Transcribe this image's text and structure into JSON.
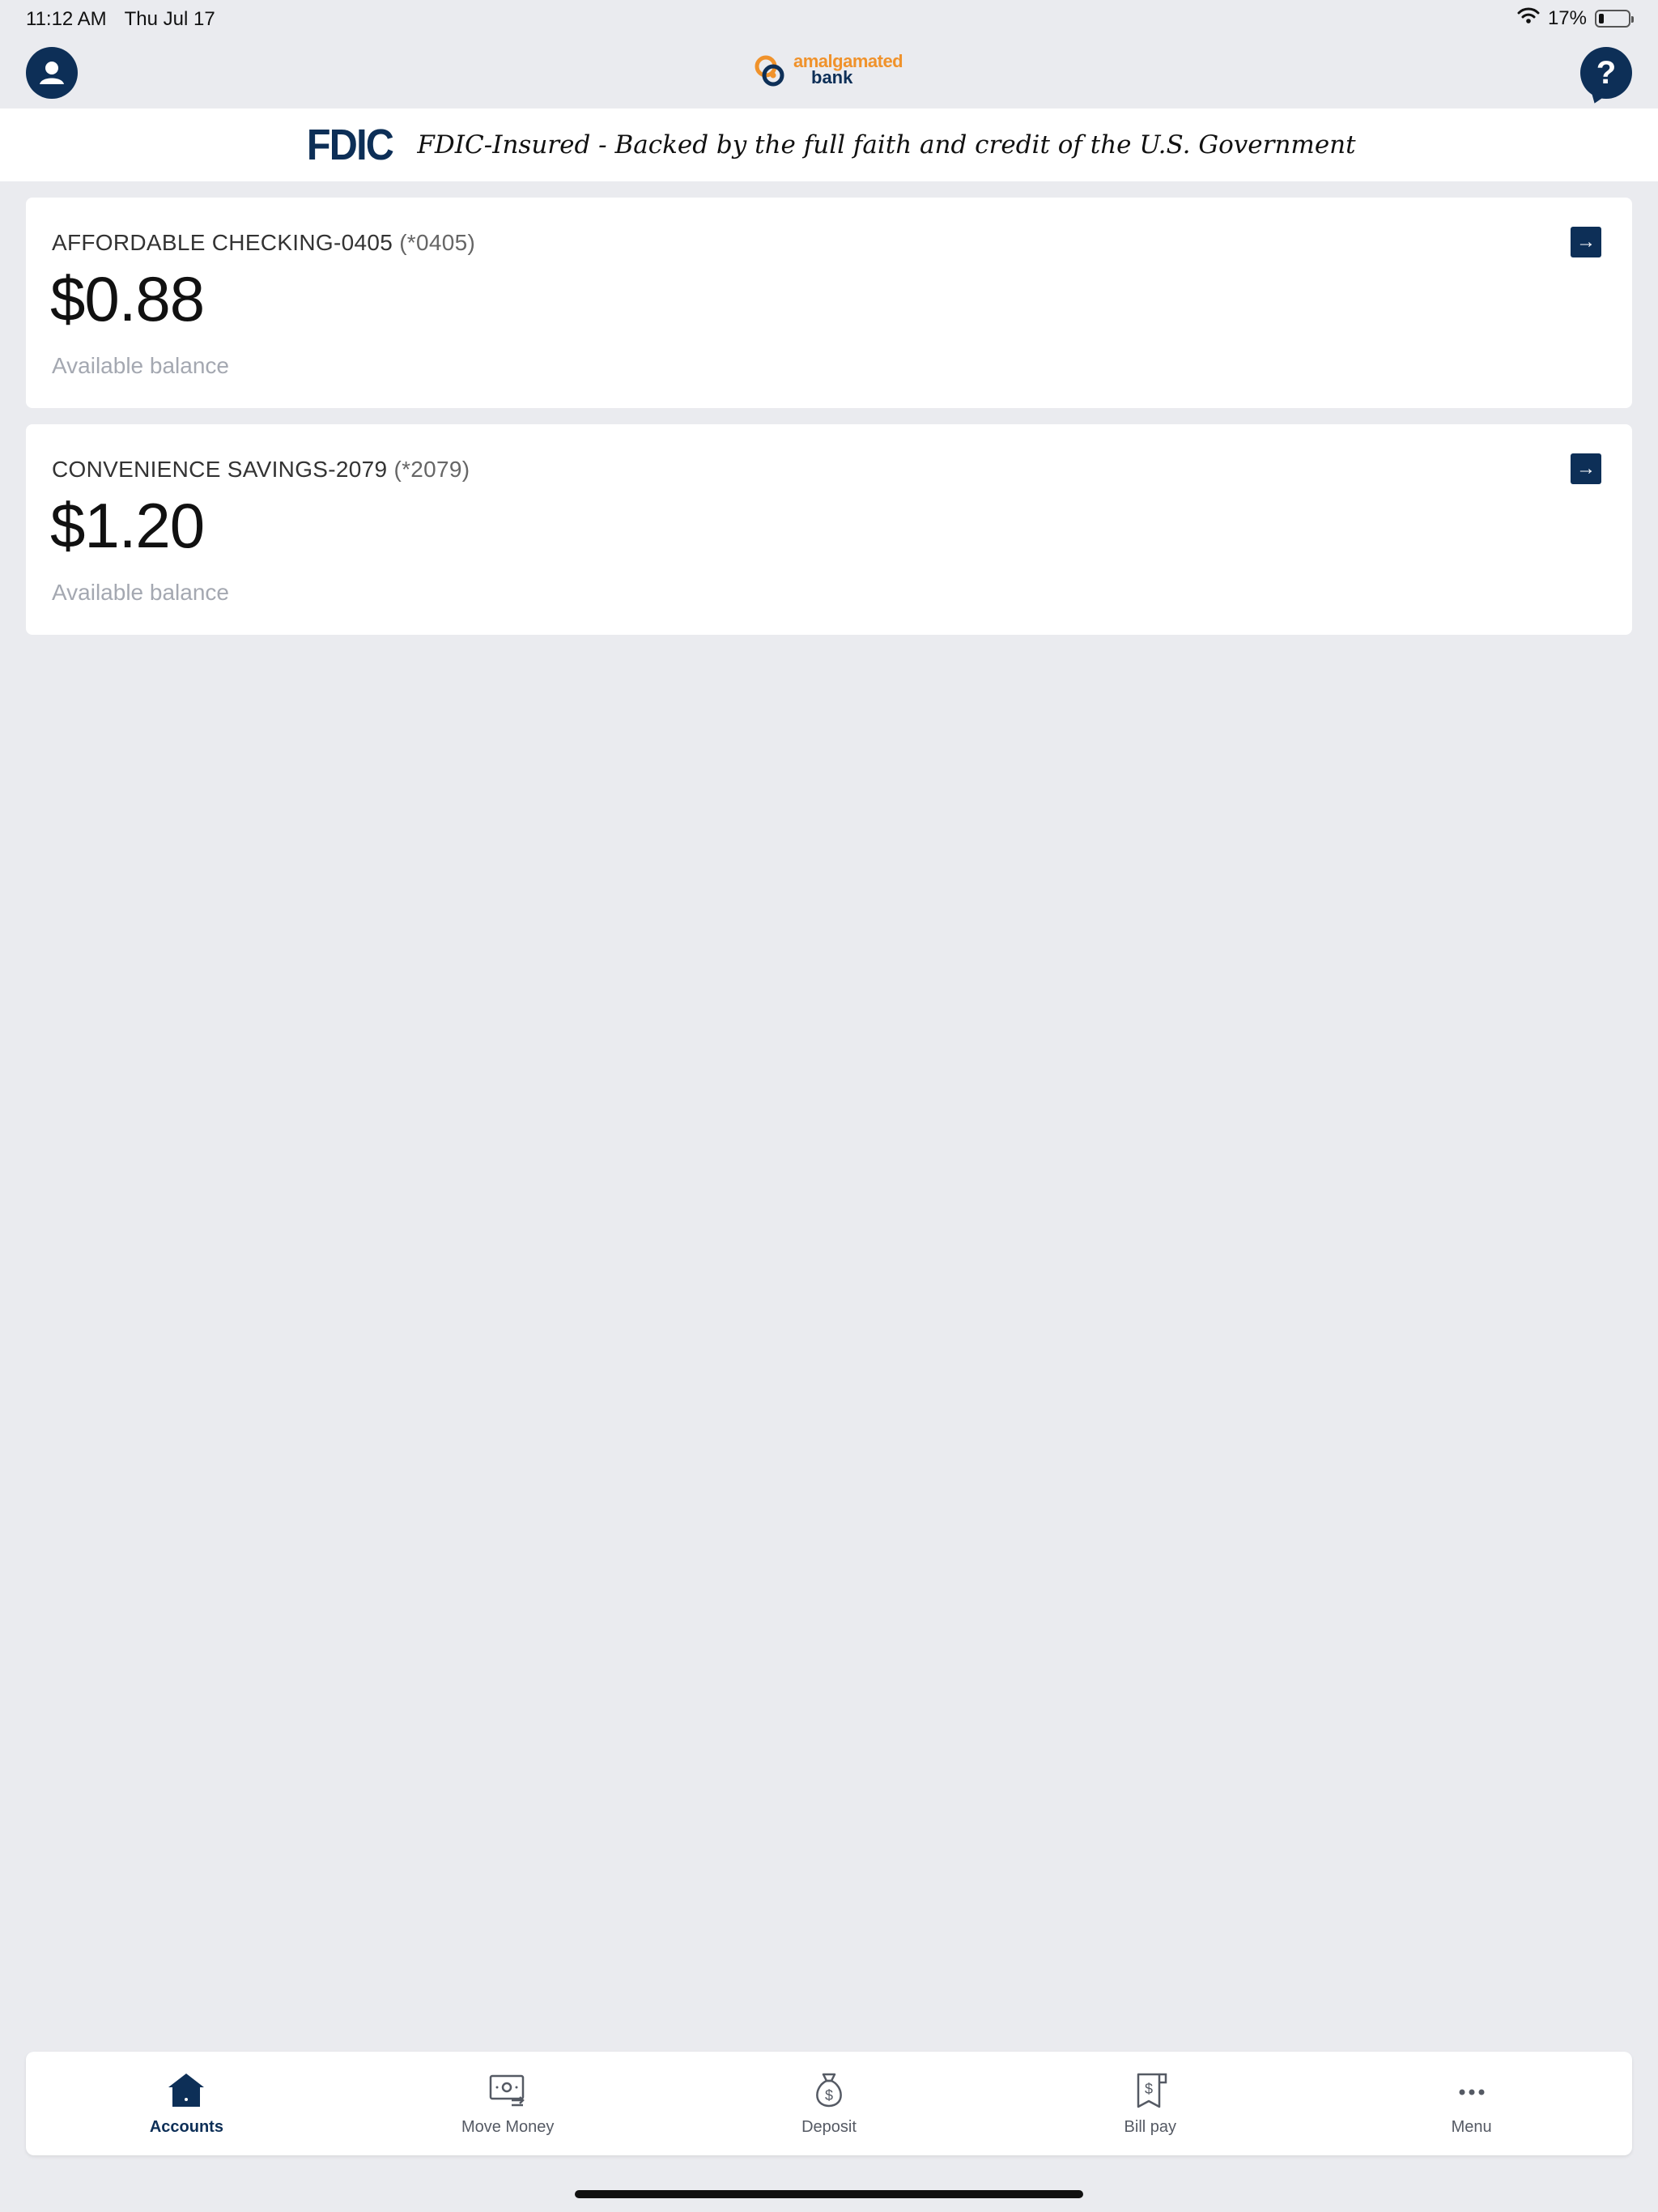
{
  "status_bar": {
    "time": "11:12 AM",
    "date": "Thu Jul 17",
    "battery": "17%",
    "battery_level": 0.17
  },
  "header": {
    "logo_line1": "amalgamated",
    "logo_line2": "bank",
    "help_symbol": "?"
  },
  "fdic": {
    "logo": "FDIC",
    "text": "FDIC-Insured - Backed by the full faith and credit of the U.S. Government"
  },
  "accounts": [
    {
      "name": "AFFORDABLE CHECKING-0405",
      "mask": "(*0405)",
      "balance": "$0.88",
      "label": "Available balance"
    },
    {
      "name": "CONVENIENCE SAVINGS-2079",
      "mask": "(*2079)",
      "balance": "$1.20",
      "label": "Available balance"
    }
  ],
  "tabs": [
    {
      "label": "Accounts",
      "icon": "home-icon"
    },
    {
      "label": "Move Money",
      "icon": "transfer-icon"
    },
    {
      "label": "Deposit",
      "icon": "money-bag-icon"
    },
    {
      "label": "Bill pay",
      "icon": "receipt-icon"
    },
    {
      "label": "Menu",
      "icon": "more-icon"
    }
  ],
  "colors": {
    "brand_navy": "#0d2f57",
    "brand_orange": "#f0922b",
    "background": "#eaebef"
  }
}
